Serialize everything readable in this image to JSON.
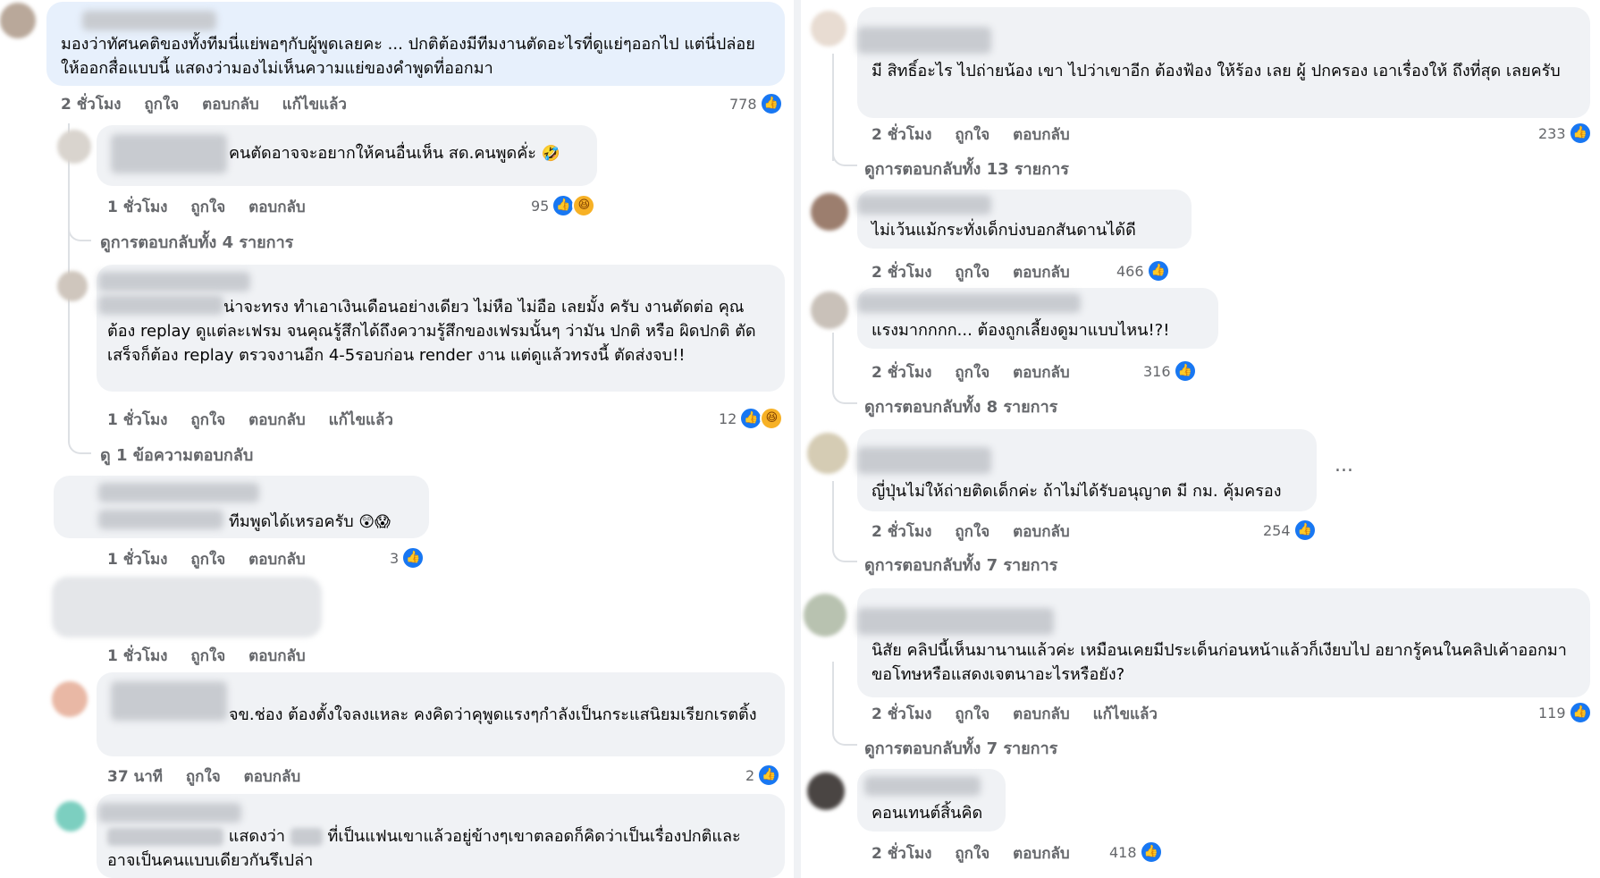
{
  "left": {
    "comments": [
      {
        "text": "มองว่าทัศนคติของทั้งทีมนี่แย่พอๆกับผู้พูดเลยคะ ... ปกติต้องมีทีมงานตัดอะไรที่ดูแย่ๆออกไป แต่นี่ปล่อยให้ออกสื่อแบบนี้ แสดงว่ามองไม่เห็นความแย่ของคำพูดที่ออกมา",
        "time": "2 ชั่วโมง",
        "like": "ถูกใจ",
        "reply": "ตอบกลับ",
        "edited": "แก้ไขแล้ว",
        "count": "778"
      },
      {
        "text": "คนตัดอาจจะอยากให้คนอื่นเห็น สด.คนพูดคั่ะ",
        "emoji": "🤣",
        "time": "1 ชั่วโมง",
        "like": "ถูกใจ",
        "reply": "ตอบกลับ",
        "count": "95",
        "replies": "ดูการตอบกลับทั้ง 4 รายการ"
      },
      {
        "text": "น่าจะทรง ทำเอาเงินเดือนอย่างเดียว ไม่หือ ไม่อือ เลยมั้ง ครับ งานตัดต่อ คุณต้อง replay ดูแต่ละเฟรม จนคุณรู้สึกได้ถึงความรู้สึกของเฟรมนั้นๆ ว่ามัน ปกติ หรือ ผิดปกติ ตัดเสร็จก็ต้อง replay ตรวจงานอีก 4-5รอบก่อน render งาน แต่ดูแล้วทรงนี้ ตัดส่งจบ!!",
        "time": "1 ชั่วโมง",
        "like": "ถูกใจ",
        "reply": "ตอบกลับ",
        "edited": "แก้ไขแล้ว",
        "count": "12",
        "replies": "ดู 1 ข้อความตอบกลับ"
      },
      {
        "text": "ทีมพูดได้เหรอครับ",
        "emoji": "😲😱",
        "time": "1 ชั่วโมง",
        "like": "ถูกใจ",
        "reply": "ตอบกลับ",
        "count": "3"
      },
      {
        "time": "1 ชั่วโมง",
        "like": "ถูกใจ",
        "reply": "ตอบกลับ"
      },
      {
        "text": "จข.ช่อง ต้องตั้งใจลงแหละ คงคิดว่าคุพูดแรงๆกำลังเป็นกระแสนิยมเรียกเรตติ้ง",
        "time": "37 นาที",
        "like": "ถูกใจ",
        "reply": "ตอบกลับ",
        "count": "2"
      },
      {
        "text_a": "แสดงว่า",
        "text_b": "ที่เป็นแฟนเขาแล้วอยู่ข้างๆเขาตลอดก็คิดว่าเป็นเรื่องปกติและอาจเป็นคนแบบเดียวกันรึเปล่า"
      }
    ]
  },
  "right": {
    "comments": [
      {
        "text": "มี สิทธิ์อะไร ไปถ่ายน้อง เขา ไปว่าเขาอีก ต้องฟ้อง ให้ร้อง เลย ผู้ ปกครอง เอาเรื่องให้ ถึงที่สุด เลยครับ",
        "time": "2 ชั่วโมง",
        "like": "ถูกใจ",
        "reply": "ตอบกลับ",
        "count": "233",
        "replies": "ดูการตอบกลับทั้ง 13 รายการ"
      },
      {
        "text": "ไม่เว้นแม้กระทั่งเด็กบ่งบอกสันดานได้ดี",
        "time": "2 ชั่วโมง",
        "like": "ถูกใจ",
        "reply": "ตอบกลับ",
        "count": "466"
      },
      {
        "text": "แรงมากกกก... ต้องถูกเลี้ยงดูมาแบบไหน!?!",
        "time": "2 ชั่วโมง",
        "like": "ถูกใจ",
        "reply": "ตอบกลับ",
        "count": "316",
        "replies": "ดูการตอบกลับทั้ง 8 รายการ"
      },
      {
        "text": "ญี่ปุ่นไม่ให้ถ่ายติดเด็กค่ะ ถ้าไม่ได้รับอนุญาต มี กม. คุ้มครอง",
        "time": "2 ชั่วโมง",
        "like": "ถูกใจ",
        "reply": "ตอบกลับ",
        "count": "254",
        "replies": "ดูการตอบกลับทั้ง 7 รายการ",
        "more": "..."
      },
      {
        "text": "นิสัย คลิปนี้เห็นมานานแล้วค่ะ เหมือนเคยมีประเด็นก่อนหน้าแล้วก็เงียบไป อยากรู้คนในคลิปเค้าออกมาขอโทษหรือแสดงเจตนาอะไรหรือยัง?",
        "time": "2 ชั่วโมง",
        "like": "ถูกใจ",
        "reply": "ตอบกลับ",
        "edited": "แก้ไขแล้ว",
        "count": "119",
        "replies": "ดูการตอบกลับทั้ง 7 รายการ"
      },
      {
        "text": "คอนเทนต์สิ้นคิด",
        "time": "2 ชั่วโมง",
        "like": "ถูกใจ",
        "reply": "ตอบกลับ",
        "count": "418"
      }
    ]
  },
  "icons": {
    "like": "thumbs-up-icon",
    "haha": "haha-reaction-icon",
    "more": "more-options-icon"
  },
  "colors": {
    "bubble": "#f0f2f5",
    "highlight_bubble": "#e7f0fc",
    "like_blue": "#1877f2",
    "meta_text": "#65676b"
  }
}
